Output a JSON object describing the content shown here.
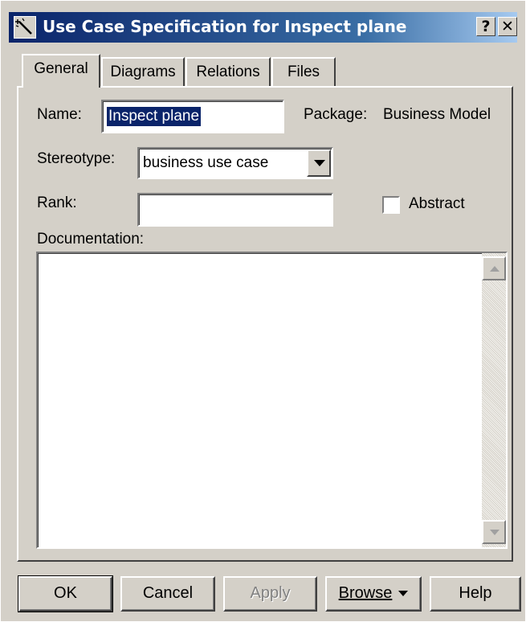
{
  "window": {
    "title": "Use Case Specification for Inspect plane",
    "help_glyph": "?",
    "close_glyph": "✕"
  },
  "tabs": [
    {
      "label": "General",
      "active": true
    },
    {
      "label": "Diagrams",
      "active": false
    },
    {
      "label": "Relations",
      "active": false
    },
    {
      "label": "Files",
      "active": false
    }
  ],
  "general": {
    "name_label": "Name:",
    "name_value": "Inspect plane",
    "package_label": "Package:",
    "package_value": "Business Model",
    "stereotype_label": "Stereotype:",
    "stereotype_value": "business use case",
    "rank_label": "Rank:",
    "rank_value": "",
    "abstract_label": "Abstract",
    "abstract_checked": false,
    "documentation_label": "Documentation:",
    "documentation_value": ""
  },
  "buttons": {
    "ok": "OK",
    "cancel": "Cancel",
    "apply": "Apply",
    "browse": "Browse",
    "help": "Help"
  },
  "colors": {
    "titlebar_start": "#0a246a",
    "titlebar_end": "#a6caf0",
    "face": "#d4d0c8",
    "selection": "#0a246a"
  }
}
